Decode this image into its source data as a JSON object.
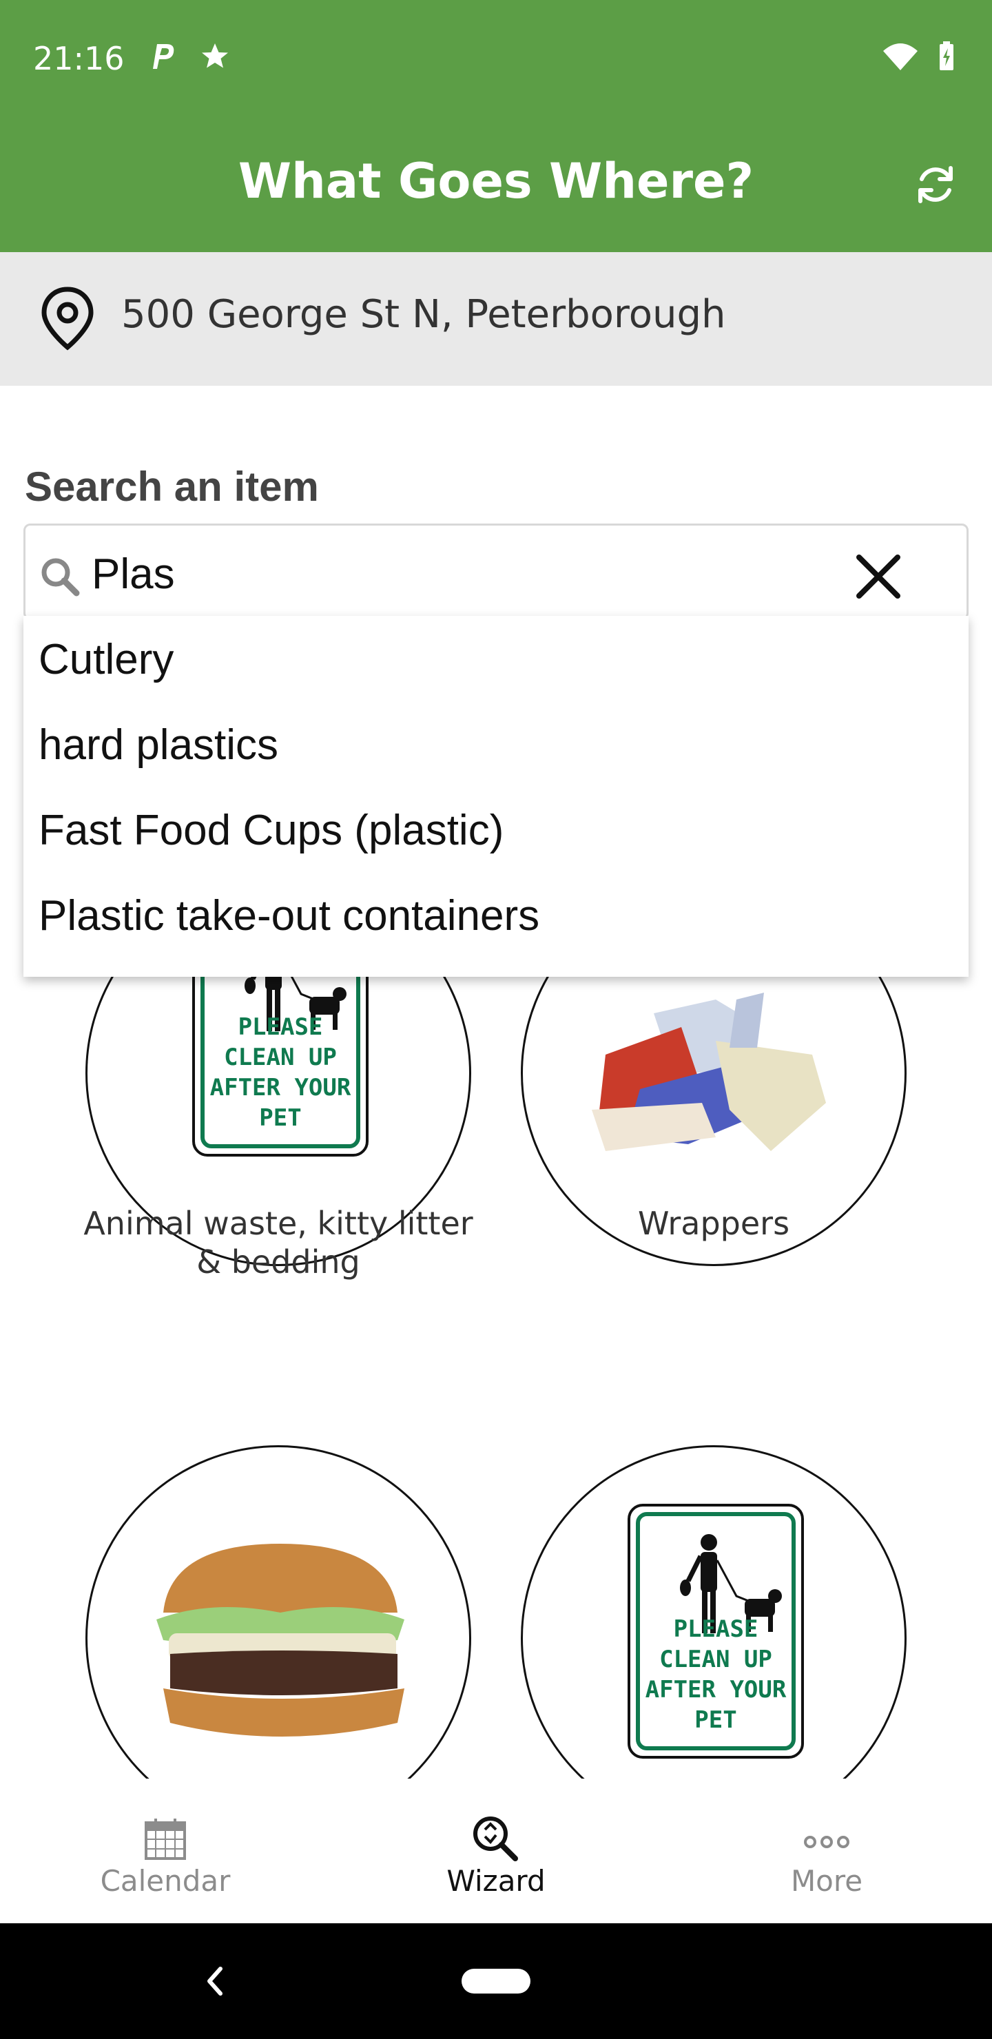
{
  "status_bar": {
    "time": "21:16"
  },
  "toolbar": {
    "title": "What Goes Where?"
  },
  "location": {
    "address": "500 George St N, Peterborough"
  },
  "search": {
    "label": "Search an item",
    "value": "Plas",
    "suggestions": [
      "Cutlery",
      "hard plastics",
      "Fast Food Cups (plastic)",
      "Plastic take-out containers"
    ]
  },
  "grid": {
    "items": [
      {
        "caption": "Animal waste, kitty litter & bedding",
        "image": "please-clean-up-after-your-pet-sign",
        "sign_text": "PLEASE CLEAN UP AFTER YOUR PET"
      },
      {
        "caption": "Wrappers",
        "image": "wrappers-photo"
      },
      {
        "caption": "",
        "image": "burger-photo"
      },
      {
        "caption": "",
        "image": "please-clean-up-after-your-pet-sign",
        "sign_text": "PLEASE CLEAN UP AFTER YOUR PET"
      }
    ]
  },
  "bottom_nav": {
    "items": [
      {
        "label": "Calendar",
        "icon": "calendar-icon",
        "active": false
      },
      {
        "label": "Wizard",
        "icon": "wizard-search-icon",
        "active": true
      },
      {
        "label": "More",
        "icon": "more-dots-icon",
        "active": false
      }
    ]
  },
  "colors": {
    "brand_green": "#5c9e46",
    "sign_green": "#0f7a4f",
    "location_bar_bg": "#e9e9e9"
  }
}
